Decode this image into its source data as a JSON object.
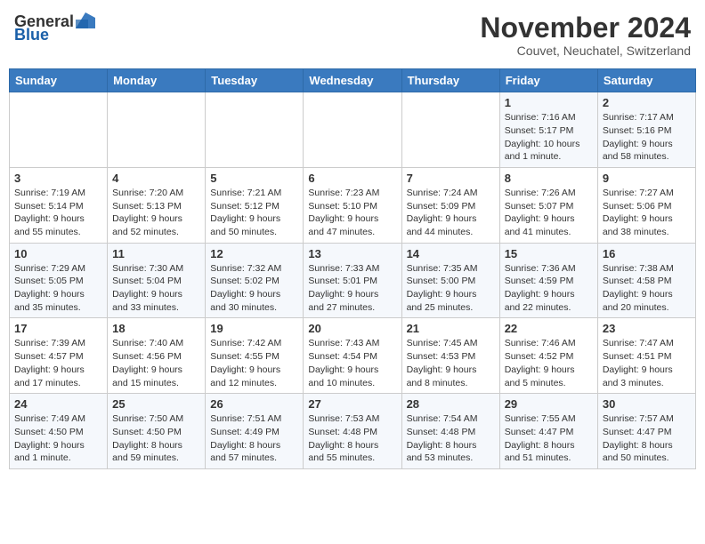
{
  "logo": {
    "general": "General",
    "blue": "Blue"
  },
  "header": {
    "month": "November 2024",
    "location": "Couvet, Neuchatel, Switzerland"
  },
  "weekdays": [
    "Sunday",
    "Monday",
    "Tuesday",
    "Wednesday",
    "Thursday",
    "Friday",
    "Saturday"
  ],
  "weeks": [
    [
      {
        "day": "",
        "info": ""
      },
      {
        "day": "",
        "info": ""
      },
      {
        "day": "",
        "info": ""
      },
      {
        "day": "",
        "info": ""
      },
      {
        "day": "",
        "info": ""
      },
      {
        "day": "1",
        "info": "Sunrise: 7:16 AM\nSunset: 5:17 PM\nDaylight: 10 hours\nand 1 minute."
      },
      {
        "day": "2",
        "info": "Sunrise: 7:17 AM\nSunset: 5:16 PM\nDaylight: 9 hours\nand 58 minutes."
      }
    ],
    [
      {
        "day": "3",
        "info": "Sunrise: 7:19 AM\nSunset: 5:14 PM\nDaylight: 9 hours\nand 55 minutes."
      },
      {
        "day": "4",
        "info": "Sunrise: 7:20 AM\nSunset: 5:13 PM\nDaylight: 9 hours\nand 52 minutes."
      },
      {
        "day": "5",
        "info": "Sunrise: 7:21 AM\nSunset: 5:12 PM\nDaylight: 9 hours\nand 50 minutes."
      },
      {
        "day": "6",
        "info": "Sunrise: 7:23 AM\nSunset: 5:10 PM\nDaylight: 9 hours\nand 47 minutes."
      },
      {
        "day": "7",
        "info": "Sunrise: 7:24 AM\nSunset: 5:09 PM\nDaylight: 9 hours\nand 44 minutes."
      },
      {
        "day": "8",
        "info": "Sunrise: 7:26 AM\nSunset: 5:07 PM\nDaylight: 9 hours\nand 41 minutes."
      },
      {
        "day": "9",
        "info": "Sunrise: 7:27 AM\nSunset: 5:06 PM\nDaylight: 9 hours\nand 38 minutes."
      }
    ],
    [
      {
        "day": "10",
        "info": "Sunrise: 7:29 AM\nSunset: 5:05 PM\nDaylight: 9 hours\nand 35 minutes."
      },
      {
        "day": "11",
        "info": "Sunrise: 7:30 AM\nSunset: 5:04 PM\nDaylight: 9 hours\nand 33 minutes."
      },
      {
        "day": "12",
        "info": "Sunrise: 7:32 AM\nSunset: 5:02 PM\nDaylight: 9 hours\nand 30 minutes."
      },
      {
        "day": "13",
        "info": "Sunrise: 7:33 AM\nSunset: 5:01 PM\nDaylight: 9 hours\nand 27 minutes."
      },
      {
        "day": "14",
        "info": "Sunrise: 7:35 AM\nSunset: 5:00 PM\nDaylight: 9 hours\nand 25 minutes."
      },
      {
        "day": "15",
        "info": "Sunrise: 7:36 AM\nSunset: 4:59 PM\nDaylight: 9 hours\nand 22 minutes."
      },
      {
        "day": "16",
        "info": "Sunrise: 7:38 AM\nSunset: 4:58 PM\nDaylight: 9 hours\nand 20 minutes."
      }
    ],
    [
      {
        "day": "17",
        "info": "Sunrise: 7:39 AM\nSunset: 4:57 PM\nDaylight: 9 hours\nand 17 minutes."
      },
      {
        "day": "18",
        "info": "Sunrise: 7:40 AM\nSunset: 4:56 PM\nDaylight: 9 hours\nand 15 minutes."
      },
      {
        "day": "19",
        "info": "Sunrise: 7:42 AM\nSunset: 4:55 PM\nDaylight: 9 hours\nand 12 minutes."
      },
      {
        "day": "20",
        "info": "Sunrise: 7:43 AM\nSunset: 4:54 PM\nDaylight: 9 hours\nand 10 minutes."
      },
      {
        "day": "21",
        "info": "Sunrise: 7:45 AM\nSunset: 4:53 PM\nDaylight: 9 hours\nand 8 minutes."
      },
      {
        "day": "22",
        "info": "Sunrise: 7:46 AM\nSunset: 4:52 PM\nDaylight: 9 hours\nand 5 minutes."
      },
      {
        "day": "23",
        "info": "Sunrise: 7:47 AM\nSunset: 4:51 PM\nDaylight: 9 hours\nand 3 minutes."
      }
    ],
    [
      {
        "day": "24",
        "info": "Sunrise: 7:49 AM\nSunset: 4:50 PM\nDaylight: 9 hours\nand 1 minute."
      },
      {
        "day": "25",
        "info": "Sunrise: 7:50 AM\nSunset: 4:50 PM\nDaylight: 8 hours\nand 59 minutes."
      },
      {
        "day": "26",
        "info": "Sunrise: 7:51 AM\nSunset: 4:49 PM\nDaylight: 8 hours\nand 57 minutes."
      },
      {
        "day": "27",
        "info": "Sunrise: 7:53 AM\nSunset: 4:48 PM\nDaylight: 8 hours\nand 55 minutes."
      },
      {
        "day": "28",
        "info": "Sunrise: 7:54 AM\nSunset: 4:48 PM\nDaylight: 8 hours\nand 53 minutes."
      },
      {
        "day": "29",
        "info": "Sunrise: 7:55 AM\nSunset: 4:47 PM\nDaylight: 8 hours\nand 51 minutes."
      },
      {
        "day": "30",
        "info": "Sunrise: 7:57 AM\nSunset: 4:47 PM\nDaylight: 8 hours\nand 50 minutes."
      }
    ]
  ]
}
